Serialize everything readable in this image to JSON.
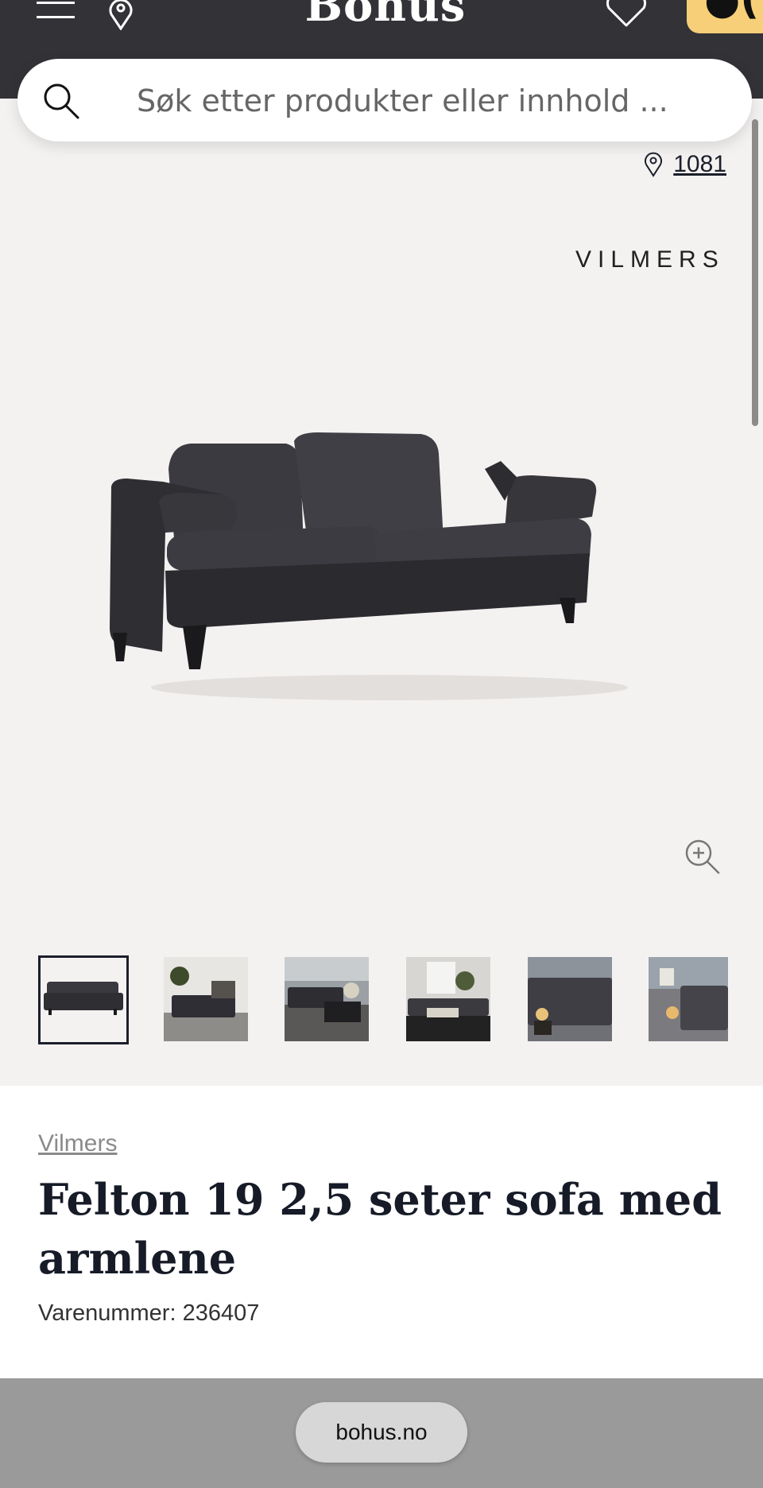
{
  "header": {
    "logo": "Bonus"
  },
  "search": {
    "placeholder": "Søk etter produkter eller innhold ..."
  },
  "store": {
    "code": "1081"
  },
  "gallery": {
    "brand_mark": "VILMERS",
    "thumbnail_count": 6,
    "active_index": 0
  },
  "product": {
    "brand": "Vilmers",
    "title": "Felton 19 2,5 seter sofa med armlene",
    "sku_label": "Varenummer:",
    "sku": "236407"
  },
  "browser": {
    "url": "bohus.no"
  },
  "colors": {
    "header_bg": "#333237",
    "accent": "#f6cf78",
    "page_bg": "#f4f2f1",
    "text_dark": "#1b1f2a"
  }
}
